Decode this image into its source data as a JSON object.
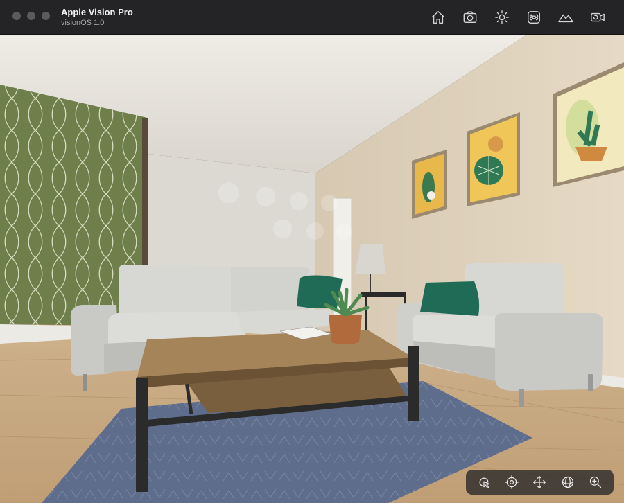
{
  "window": {
    "title": "Apple Vision Pro",
    "subtitle": "visionOS 1.0"
  },
  "toolbar": {
    "buttons": [
      {
        "icon": "home-icon"
      },
      {
        "icon": "camera-icon"
      },
      {
        "icon": "brightness-icon"
      },
      {
        "icon": "command-icon"
      },
      {
        "icon": "mountains-icon"
      },
      {
        "icon": "video-camera-icon"
      }
    ]
  },
  "scene": {
    "description_colors": {
      "wall_left": "#6f7f4c",
      "wall_back": "#dcd9d2",
      "wall_right": "#e1d4bf",
      "ceiling": "#ebe7df",
      "floor": "#c6a983",
      "rug": "#5f6d8c",
      "sofa": "#cfcfcc",
      "pillow": "#1f6b56",
      "table_top": "#9c7d55"
    }
  },
  "controls": {
    "buttons": [
      {
        "icon": "pointer-icon"
      },
      {
        "icon": "target-icon"
      },
      {
        "icon": "move-icon"
      },
      {
        "icon": "orbit-icon"
      },
      {
        "icon": "zoom-icon"
      }
    ]
  }
}
